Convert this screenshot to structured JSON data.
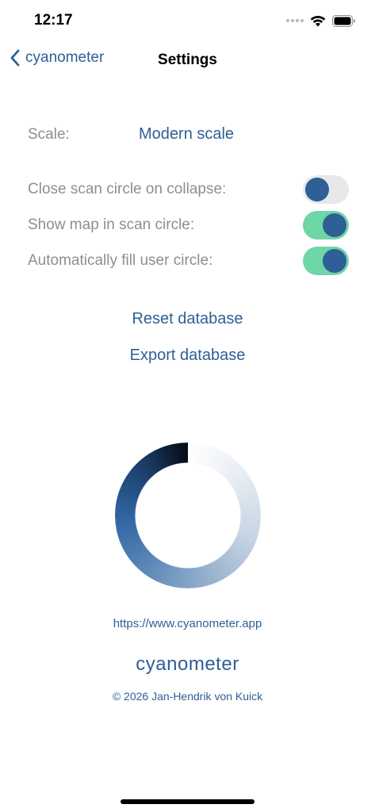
{
  "status_bar": {
    "time": "12:17",
    "icons": [
      "signal-icon",
      "wifi-icon",
      "battery-icon"
    ]
  },
  "nav": {
    "back_label": "cyanometer",
    "title": "Settings"
  },
  "scale": {
    "label": "Scale:",
    "value": "Modern scale"
  },
  "toggles": [
    {
      "label": "Close scan circle on collapse:",
      "on": false
    },
    {
      "label": "Show map in scan circle:",
      "on": true
    },
    {
      "label": "Automatically fill user circle:",
      "on": true
    }
  ],
  "actions": {
    "reset": "Reset database",
    "export": "Export database"
  },
  "footer": {
    "url": "https://www.cyanometer.app",
    "brand": "cyanometer",
    "copyright": "© 2026 Jan-Hendrik von Kuick"
  },
  "colors": {
    "accent": "#2e5f96",
    "toggle_on": "#6fd6a6",
    "toggle_off": "#e8e8ea",
    "label_gray": "#8e8e93"
  }
}
